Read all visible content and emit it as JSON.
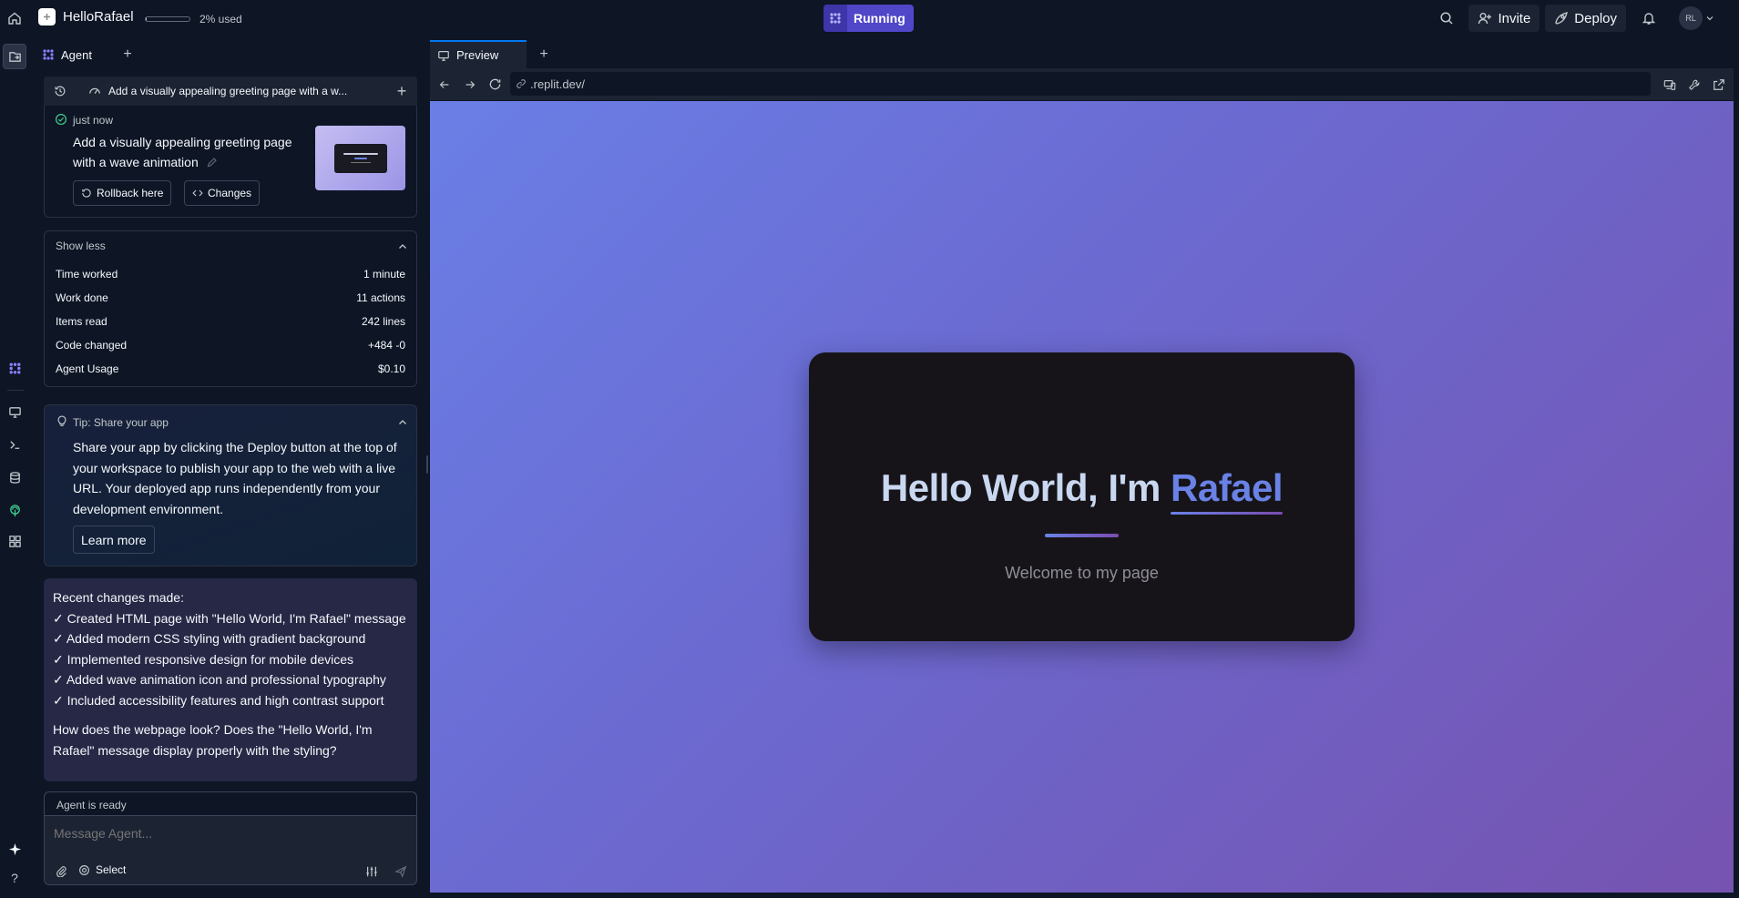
{
  "topbar": {
    "repl_name": "HelloRafael",
    "usage_text": "2% used",
    "usage_fraction": 0.02,
    "run_status": "Running",
    "invite_label": "Invite",
    "deploy_label": "Deploy",
    "avatar_initials": "RL"
  },
  "agent": {
    "tab_label": "Agent",
    "session_title": "Add a visually appealing greeting page with a w...",
    "checkpoint": {
      "time": "just now",
      "message_line1": "Add a visually appealing greeting page",
      "message_line2": "with a wave animation",
      "rollback_label": "Rollback here",
      "changes_label": "Changes"
    },
    "stats": {
      "toggle_label": "Show less",
      "rows": [
        {
          "label": "Time worked",
          "value": "1 minute"
        },
        {
          "label": "Work done",
          "value": "11 actions"
        },
        {
          "label": "Items read",
          "value": "242 lines"
        },
        {
          "label": "Code changed",
          "value": "+484 -0"
        },
        {
          "label": "Agent Usage",
          "value": "$0.10"
        }
      ]
    },
    "tip": {
      "title": "Tip: Share your app",
      "lines": [
        "Share your app by clicking the Deploy button at the top of",
        "your workspace to publish your app to the web with a live",
        "URL. Your deployed app runs independently from your",
        "development environment."
      ],
      "learn_more_label": "Learn more"
    },
    "changes_message": {
      "heading": "Recent changes made:",
      "items": [
        "✓ Created HTML page with \"Hello World, I'm Rafael\" message",
        "✓ Added modern CSS styling with gradient background",
        "✓ Implemented responsive design for mobile devices",
        "✓ Added wave animation icon and professional typography",
        "✓ Included accessibility features and high contrast support"
      ],
      "question_line1": "How does the webpage look? Does the \"Hello World, I'm",
      "question_line2": "Rafael\" message display properly with the styling?"
    },
    "status": "Agent is ready",
    "input_placeholder": "Message Agent...",
    "select_label": "Select"
  },
  "preview": {
    "tab_label": "Preview",
    "url": ".replit.dev/",
    "page": {
      "title_prefix": "Hello World, I'm ",
      "title_name": "Rafael",
      "subtitle": "Welcome to my page"
    }
  },
  "colors": {
    "app_bg": "#0e1525",
    "panel_bg": "#1c2333",
    "running_accent": "#4f46c8",
    "gradient_start": "#6a7fe6",
    "gradient_end": "#7653b0",
    "name_accent": "#6a82e6"
  }
}
